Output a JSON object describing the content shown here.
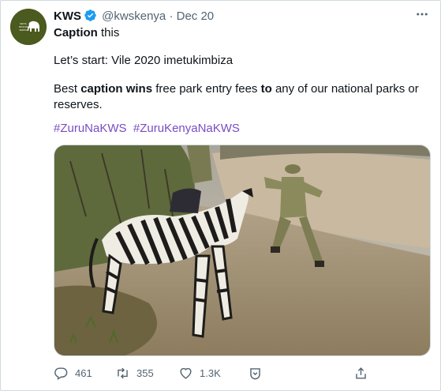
{
  "account": {
    "name": "KWS",
    "handle": "@kwskenya",
    "separator": "·",
    "date": "Dec 20",
    "avatar_text": [
      "KENYA",
      "WILDLIFE",
      "SERVICE"
    ]
  },
  "tweet": {
    "line1_bold": "Caption",
    "line1_rest": " this",
    "line2": "Let’s start: Vile 2020 imetukimbiza",
    "line3": {
      "a": "Best ",
      "b": "caption wins",
      "c": " free park entry fees ",
      "d": "to",
      "e": " any of our national parks or reserves."
    },
    "hashtags": [
      "#ZuruNaKWS",
      "#ZuruKenyaNaKWS"
    ]
  },
  "actions": {
    "replies": "461",
    "retweets": "355",
    "likes": "1.3K"
  },
  "colors": {
    "hashtag": "#794bc4",
    "verified": "#1d9bf0",
    "muted": "#536471",
    "avatar_bg": "#4b5a1e"
  },
  "icons": [
    "verified-badge-icon",
    "more-icon",
    "reply-icon",
    "retweet-icon",
    "like-icon",
    "bookmark-icon",
    "share-icon"
  ]
}
